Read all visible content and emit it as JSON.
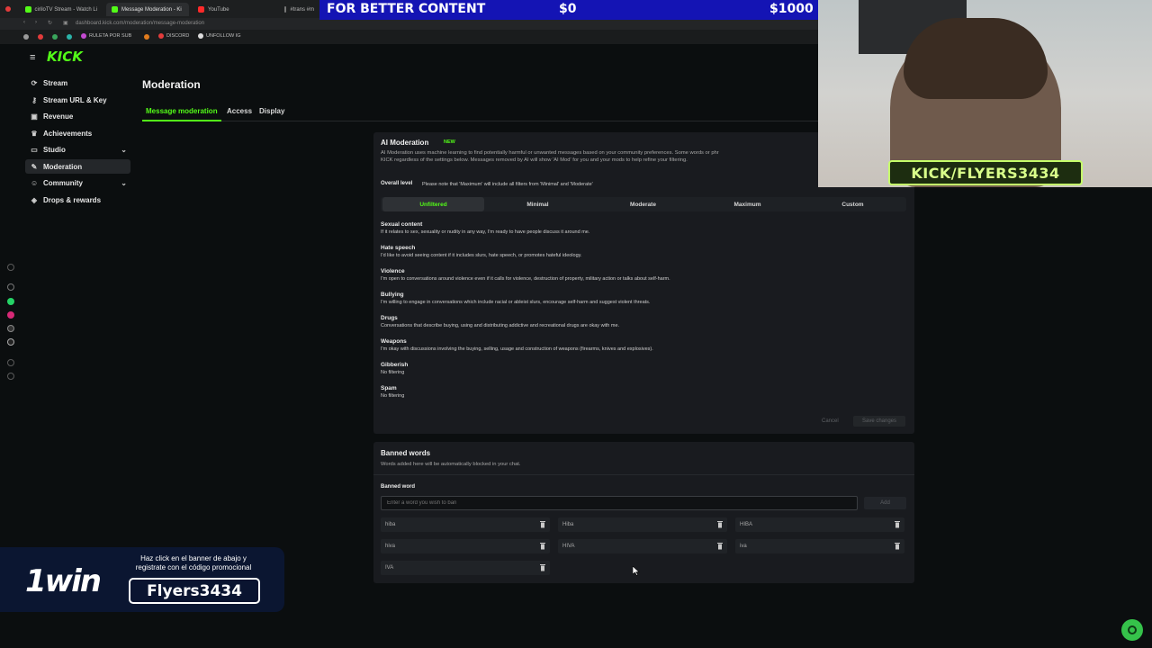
{
  "browser": {
    "tabs": [
      {
        "label": "ciriloTV Stream - Watch Li"
      },
      {
        "label": "Message Moderation - Ki"
      },
      {
        "label": "YouTube"
      },
      {
        "label": "#trans #m"
      }
    ],
    "url": "dashboard.kick.com/moderation/message-moderation",
    "bookmarks": [
      "RULETA POR SUB",
      "DISCORD",
      "UNFOLLOW IG"
    ]
  },
  "overlay": {
    "banner_left": "FOR BETTER CONTENT",
    "banner_mid": "$0",
    "banner_right": "$1000",
    "kick_tag": "KICK/FLYERS3434",
    "promo_logo": "1win",
    "promo_text": "Haz click en el banner de abajo y registrate con el código promocional",
    "promo_code": "Flyers3434"
  },
  "sidebar": {
    "logo": "KICK",
    "items": [
      {
        "label": "Stream",
        "icon": "stream-icon"
      },
      {
        "label": "Stream URL & Key",
        "icon": "key-icon"
      },
      {
        "label": "Revenue",
        "icon": "wallet-icon"
      },
      {
        "label": "Achievements",
        "icon": "trophy-icon"
      },
      {
        "label": "Studio",
        "icon": "studio-icon"
      },
      {
        "label": "Moderation",
        "icon": "wrench-icon"
      },
      {
        "label": "Community",
        "icon": "people-icon"
      },
      {
        "label": "Drops & rewards",
        "icon": "gift-icon"
      }
    ]
  },
  "main": {
    "title": "Moderation",
    "tabs": [
      {
        "label": "Message moderation"
      },
      {
        "label": "Access"
      },
      {
        "label": "Display"
      }
    ]
  },
  "ai": {
    "title": "AI Moderation",
    "badge": "NEW",
    "desc1": "AI Moderation uses machine learning to find potentially harmful or unwanted messages based on your community preferences. Some words or phr",
    "desc2": "KICK regardless of the settings below. Messages removed by AI will show 'AI Mod' for you and your mods to help refine your filtering.",
    "overall_label": "Overall level",
    "overall_note": "Please note that 'Maximum' will include all filters from 'Minimal' and 'Moderate'",
    "levels": [
      "Unfiltered",
      "Minimal",
      "Moderate",
      "Maximum",
      "Custom"
    ],
    "selected_level": "Unfiltered",
    "categories": [
      {
        "title": "Sexual content",
        "desc": "If it relates to sex, sexuality or nudity in any way, I'm ready to have people discuss it around me."
      },
      {
        "title": "Hate speech",
        "desc": "I'd like to avoid seeing content if it includes slurs, hate speech, or promotes hateful ideology."
      },
      {
        "title": "Violence",
        "desc": "I'm open to conversations around violence even if it calls for violence, destruction of property, military action or talks about self-harm."
      },
      {
        "title": "Bullying",
        "desc": "I'm willing to engage in conversations which include racial or ableist slurs, encourage self-harm and suggest violent threats."
      },
      {
        "title": "Drugs",
        "desc": "Conversations that describe buying, using and distributing addictive and recreational drugs are okay with me."
      },
      {
        "title": "Weapons",
        "desc": "I'm okay with discussions involving the buying, selling, usage and construction of weapons (firearms, knives and explosives)."
      },
      {
        "title": "Gibberish",
        "desc": "No filtering"
      },
      {
        "title": "Spam",
        "desc": "No filtering"
      }
    ],
    "cancel": "Cancel",
    "save": "Save changes"
  },
  "banned": {
    "title": "Banned words",
    "desc": "Words added here will be automatically blocked in your chat.",
    "field_label": "Banned word",
    "placeholder": "Enter a word you wish to ban",
    "add": "Add",
    "words": [
      "hiba",
      "Hiba",
      "HIBA",
      "hiva",
      "HIVA",
      "iva",
      "IVA"
    ]
  },
  "colors": {
    "accent": "#53fc18",
    "panel": "#191b1f",
    "bg": "#0b0e0f"
  }
}
